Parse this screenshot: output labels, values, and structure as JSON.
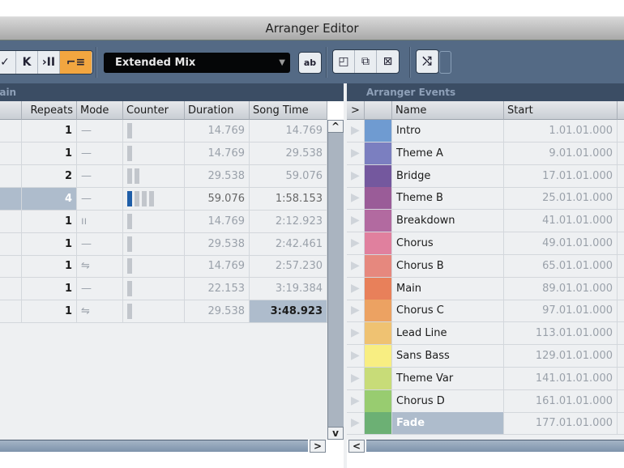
{
  "window": {
    "title": "Arranger Editor"
  },
  "toolbar": {
    "buttons": [
      "✓",
      "K",
      "›II",
      "⌐≡"
    ],
    "chain_select": "Extended Mix",
    "rename_icon": "ab",
    "view_buttons": [
      "◰",
      "⧉",
      "⊠"
    ],
    "flatten_icon": "⤭"
  },
  "chain": {
    "section_title": "Chain",
    "columns": [
      "Repeats",
      "Mode",
      "Counter",
      "Duration",
      "Song Time"
    ],
    "rows": [
      {
        "repeats": "1",
        "mode": "—",
        "counter": 1,
        "counter_active": 0,
        "duration": "14.769",
        "song_time": "14.769"
      },
      {
        "repeats": "1",
        "mode": "—",
        "counter": 1,
        "counter_active": 0,
        "duration": "14.769",
        "song_time": "29.538"
      },
      {
        "repeats": "2",
        "mode": "—",
        "counter": 2,
        "counter_active": 0,
        "duration": "29.538",
        "song_time": "59.076"
      },
      {
        "repeats": "4",
        "mode": "—",
        "counter": 4,
        "counter_active": 1,
        "duration": "59.076",
        "song_time": "1:58.153"
      },
      {
        "repeats": "1",
        "mode": "ıı",
        "counter": 1,
        "counter_active": 0,
        "duration": "14.769",
        "song_time": "2:12.923"
      },
      {
        "repeats": "1",
        "mode": "—",
        "counter": 1,
        "counter_active": 0,
        "duration": "29.538",
        "song_time": "2:42.461"
      },
      {
        "repeats": "1",
        "mode": "⇋",
        "counter": 1,
        "counter_active": 0,
        "duration": "14.769",
        "song_time": "2:57.230"
      },
      {
        "repeats": "1",
        "mode": "—",
        "counter": 1,
        "counter_active": 0,
        "duration": "22.153",
        "song_time": "3:19.384"
      },
      {
        "repeats": "1",
        "mode": "⇋",
        "counter": 1,
        "counter_active": 0,
        "duration": "29.538",
        "song_time": "3:48.923"
      }
    ]
  },
  "events": {
    "section_title": "Arranger Events",
    "columns": [
      ">",
      "Name",
      "Start"
    ],
    "rows": [
      {
        "name": "Intro",
        "start": "1.01.01.000",
        "color": "#6f9bd1"
      },
      {
        "name": "Theme A",
        "start": "9.01.01.000",
        "color": "#7b7fc0"
      },
      {
        "name": "Bridge",
        "start": "17.01.01.000",
        "color": "#74589e"
      },
      {
        "name": "Theme B",
        "start": "25.01.01.000",
        "color": "#9a5c98"
      },
      {
        "name": "Breakdown",
        "start": "41.01.01.000",
        "color": "#b26aa0"
      },
      {
        "name": "Chorus",
        "start": "49.01.01.000",
        "color": "#e0809e"
      },
      {
        "name": "Chorus B",
        "start": "65.01.01.000",
        "color": "#e6887e"
      },
      {
        "name": "Main",
        "start": "89.01.01.000",
        "color": "#e8805a"
      },
      {
        "name": "Chorus C",
        "start": "97.01.01.000",
        "color": "#eca262"
      },
      {
        "name": "Lead Line",
        "start": "113.01.01.000",
        "color": "#efc272"
      },
      {
        "name": "Sans Bass",
        "start": "129.01.01.000",
        "color": "#f8ee82"
      },
      {
        "name": "Theme Var",
        "start": "141.01.01.000",
        "color": "#c8dc78"
      },
      {
        "name": "Chorus D",
        "start": "161.01.01.000",
        "color": "#98cc70"
      },
      {
        "name": "Fade",
        "start": "177.01.01.000",
        "color": "#6cb074"
      }
    ]
  },
  "colors": {
    "accent": "#f2a640",
    "selection": "#aebccc",
    "counter_active": "#1f5ea8"
  }
}
